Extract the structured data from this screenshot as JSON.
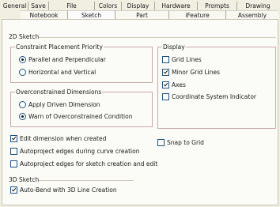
{
  "tabs_top": [
    "General",
    "Save",
    "File",
    "Colors",
    "Display",
    "Hardware",
    "Prompts",
    "Drawing"
  ],
  "tabs_bottom": [
    "Notebook",
    "Sketch",
    "Part",
    "iFeature",
    "Assembly"
  ],
  "active_tab": "Sketch",
  "sketch2d": {
    "title": "2D Sketch",
    "constraint_group": {
      "title": "Constraint Placement Priority",
      "options": [
        {
          "label": "Parallel and Perpendicular",
          "selected": true
        },
        {
          "label": "Horizontal and Vertical",
          "selected": false
        }
      ]
    },
    "overconstrained_group": {
      "title": "Overconstrained Dimensions",
      "options": [
        {
          "label": "Apply Driven Dimension",
          "selected": false
        },
        {
          "label": "Warn of Overconstrained Condition",
          "selected": true
        }
      ]
    },
    "display_group": {
      "title": "Display",
      "items": [
        {
          "label": "Grid Lines",
          "checked": false
        },
        {
          "label": "Minor Grid Lines",
          "checked": true
        },
        {
          "label": "Axes",
          "checked": true
        },
        {
          "label": "Coordinate System Indicator",
          "checked": false
        }
      ]
    },
    "snap_to_grid": {
      "label": "Snap to Grid",
      "checked": false
    },
    "edit_dimension": {
      "label": "Edit dimension when created",
      "checked": true
    },
    "autoproject_curve": {
      "label": "Autoproject edges during curve creation",
      "checked": false
    },
    "autoproject_sketch": {
      "label": "Autoproject edges for sketch creation and edit",
      "checked": false
    }
  },
  "sketch3d": {
    "title": "3D Sketch",
    "auto_bend": {
      "label": "Auto-Bend with 3D Line Creation",
      "checked": true
    }
  }
}
